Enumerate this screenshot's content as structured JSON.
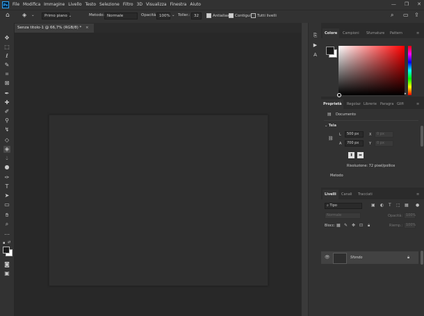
{
  "app": {
    "logo": "Ps"
  },
  "menu": [
    "File",
    "Modifica",
    "Immagine",
    "Livello",
    "Testo",
    "Selezione",
    "Filtro",
    "3D",
    "Visualizza",
    "Finestra",
    "Aiuto"
  ],
  "window_controls": {
    "minimize": "—",
    "restore": "❐",
    "close": "✕"
  },
  "options_bar": {
    "mode_select": "Primo piano",
    "method_label": "Metodo:",
    "method_value": "Normale",
    "opacity_label": "Opacità:",
    "opacity_value": "100%",
    "tolerance_label": "Toller.:",
    "tolerance_value": "32",
    "antialias_label": "Antialias",
    "contiguous_label": "Contigui",
    "all_layers_label": "Tutti livelli"
  },
  "document": {
    "tab_title": "Senza titolo-1 @ 66,7% (RGB/8) *",
    "close": "×"
  },
  "color_panel": {
    "tabs": [
      "Colore",
      "Campioni",
      "Sfumature",
      "Pattern"
    ],
    "active": 0
  },
  "properties_panel": {
    "tabs": [
      "Proprietà",
      "Regolaz",
      "Librerie",
      "Paragra",
      "Glifi"
    ],
    "active": 0,
    "type_label": "Documento",
    "section": "Tela",
    "w_label": "L",
    "w_value": "500 px",
    "h_label": "A",
    "h_value": "700 px",
    "x_label": "X",
    "x_value": "0 px",
    "y_label": "Y",
    "y_value": "0 px",
    "resolution": "Risoluzione: 72 pixel/pollice",
    "mode_label": "Metodo"
  },
  "layers_panel": {
    "tabs": [
      "Livelli",
      "Canali",
      "Tracciati"
    ],
    "active": 0,
    "filter_placeholder": "Tipo",
    "blend_mode": "Normale",
    "opacity_label": "Opacità:",
    "opacity_value": "100%",
    "lock_label": "Blocc:",
    "fill_label": "Riemp.:",
    "fill_value": "100%",
    "layers": [
      {
        "name": "Sfondo",
        "visible": true,
        "locked": true
      }
    ]
  },
  "colors": {
    "foreground": "#1a1a1a",
    "background": "#fefefe",
    "accent": "#31a8ff"
  }
}
